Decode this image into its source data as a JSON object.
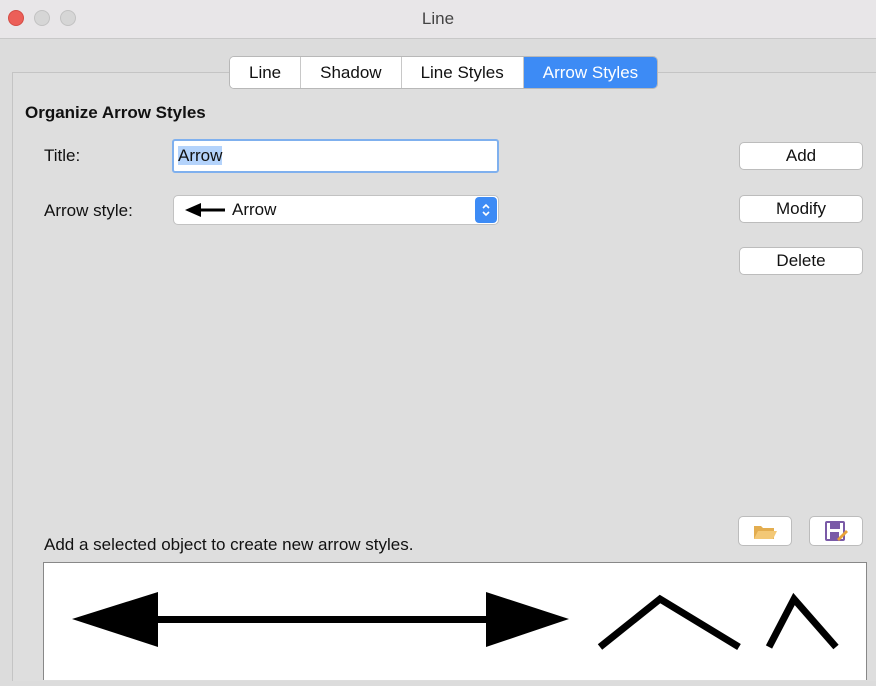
{
  "window": {
    "title": "Line"
  },
  "tabs": [
    {
      "label": "Line",
      "active": false
    },
    {
      "label": "Shadow",
      "active": false
    },
    {
      "label": "Line Styles",
      "active": false
    },
    {
      "label": "Arrow Styles",
      "active": true
    }
  ],
  "section": {
    "title": "Organize Arrow Styles"
  },
  "form": {
    "title_label": "Title:",
    "title_value": "Arrow",
    "arrow_style_label": "Arrow style:",
    "arrow_style_value": "Arrow"
  },
  "buttons": {
    "add": "Add",
    "modify": "Modify",
    "delete": "Delete"
  },
  "icons": {
    "load": "folder-open-icon",
    "save": "save-icon",
    "arrow_preview": "arrow-icon",
    "stepper": "updown-chevron-icon"
  },
  "hint": "Add a selected object to create new arrow styles.",
  "colors": {
    "accent": "#3d8bf5",
    "close": "#ec5f58",
    "selection": "#b4d3fb"
  }
}
